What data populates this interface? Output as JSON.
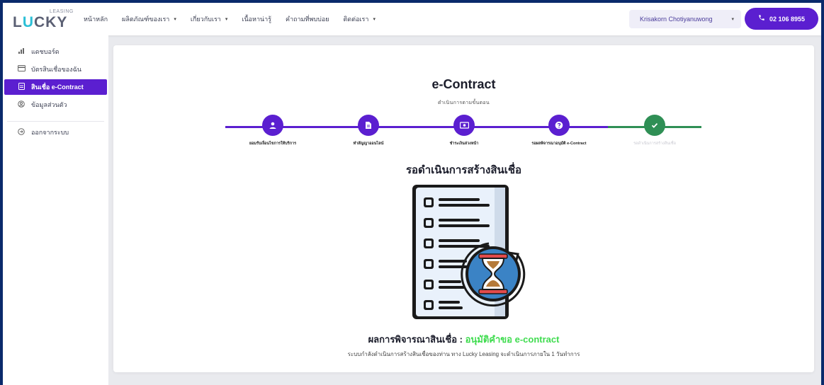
{
  "brand": {
    "word": "LUCKY",
    "subword": "LEASING"
  },
  "nav": {
    "items": [
      {
        "label": "หน้าหลัก",
        "has_caret": false
      },
      {
        "label": "ผลิตภัณฑ์ของเรา",
        "has_caret": true
      },
      {
        "label": "เกี่ยวกับเรา",
        "has_caret": true
      },
      {
        "label": "เนื้อหาน่ารู้",
        "has_caret": false
      },
      {
        "label": "คำถามที่พบบ่อย",
        "has_caret": false
      },
      {
        "label": "ติดต่อเรา",
        "has_caret": true
      }
    ],
    "caret": "▾"
  },
  "user": {
    "name": "Krisakorn Chotiyanuwong",
    "caret": "▾"
  },
  "phone": {
    "icon": "phone-icon",
    "label": "02 106 8955"
  },
  "sidebar": {
    "items": [
      {
        "label": "แดชบอร์ด",
        "icon": "chart-icon",
        "active": false
      },
      {
        "label": "บัตรสินเชื่อของฉัน",
        "icon": "card-icon",
        "active": false
      },
      {
        "label": "สินเชื่อ e-Contract",
        "icon": "document-icon",
        "active": true
      },
      {
        "label": "ข้อมูลส่วนตัว",
        "icon": "user-circle-icon",
        "active": false
      }
    ],
    "logout": {
      "label": "ออกจากระบบ",
      "icon": "logout-icon"
    }
  },
  "main": {
    "title": "e-Contract",
    "subtitle": "ดำเนินการตามขั้นตอน",
    "steps": [
      {
        "label": "ยอมรับเงื่อนไขการให้บริการ",
        "icon": "user-icon",
        "state": "active"
      },
      {
        "label": "ทำสัญญาออนไลน์",
        "icon": "file-icon",
        "state": "active"
      },
      {
        "label": "ชำระเงินล่วงหน้า",
        "icon": "money-icon",
        "state": "active"
      },
      {
        "label": "รอผลพิจารณาอนุมัติ e-Contract",
        "icon": "question-icon",
        "state": "active"
      },
      {
        "label": "รอดำเนินการสร้างสินเชื่อ",
        "icon": "check-icon",
        "state": "done"
      }
    ],
    "status_title": "รอดำเนินการสร้างสินเชื่อ",
    "result_prefix": "ผลการพิจารณาสินเชื่อ : ",
    "result_value": "อนุมัติคำขอ e-contract",
    "note": "ระบบกำลังดำเนินการสร้างสินเชื่อของท่าน ทาง Lucky Leasing จะดำเนินการภายใน 1 วันทำการ"
  },
  "colors": {
    "primary": "#5b1fd0",
    "success": "#2f8f55",
    "approved_text": "#3fdc4f",
    "frame": "#0a2a6b"
  }
}
